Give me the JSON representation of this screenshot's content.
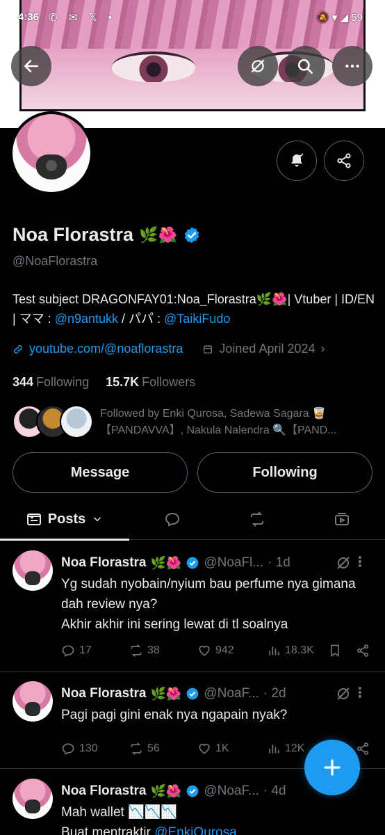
{
  "status_bar": {
    "time": "4:36",
    "notif_icons": "✆ ✉ 𝕏 •",
    "right_icons": "🔕 ▾ ◢ 59"
  },
  "profile": {
    "name": "Noa Florastra",
    "name_emojis": "🌿🌺",
    "handle": "@NoaFlorastra",
    "bio_line1": "Test subject DRAGONFAY01:Noa_Florastra🌿🌺| Vtuber | ID/EN | ママ : ",
    "bio_mama": "@n9antukk",
    "bio_sep": " / パパ : ",
    "bio_papa": "@TaikiFudo",
    "website": "youtube.com/@noaflorastra",
    "joined": "Joined April 2024",
    "following_count": "344",
    "following_label": "Following",
    "followers_count": "15.7K",
    "followers_label": "Followers",
    "followed_by": "Followed by Enki Qurosa, Sadewa Sagara 🥃【PANDAVVA】, Nakula Nalendra 🔍【PAND..."
  },
  "buttons": {
    "message": "Message",
    "following": "Following"
  },
  "tabs": {
    "posts": "Posts"
  },
  "posts": [
    {
      "name": "Noa Florastra",
      "emojis": "🌿🌺",
      "handle": "@NoaFl...",
      "time": "· 1d",
      "text": "Yg sudah nyobain/nyium bau perfume nya gimana dah review nya?\nAkhir akhir ini sering lewat di tl soalnya",
      "replies": "17",
      "reposts": "38",
      "likes": "942",
      "views": "18.3K"
    },
    {
      "name": "Noa Florastra",
      "emojis": "🌿🌺",
      "handle": "@NoaF...",
      "time": "· 2d",
      "text": "Pagi pagi gini enak nya ngapain nyak?",
      "replies": "130",
      "reposts": "56",
      "likes": "1K",
      "views": "12K"
    },
    {
      "name": "Noa Florastra",
      "emojis": "🌿🌺",
      "handle": "@NoaF...",
      "time": "· 4d",
      "text_line1": "Mah wallet 📉📉📉",
      "text_line2_prefix": "Buat mentraktir ",
      "text_line2_mention": "@EnkiQurosa"
    }
  ],
  "colors": {
    "accent": "#1d9bf0",
    "background": "#000000",
    "muted": "#71767b",
    "text": "#e7e9ea"
  }
}
